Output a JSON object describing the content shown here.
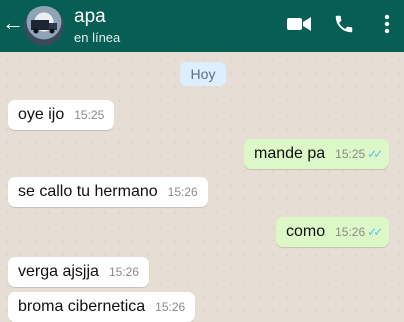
{
  "header": {
    "contact_name": "apa",
    "status": "en línea",
    "icons": [
      "back-arrow-icon",
      "video-call-icon",
      "phone-icon",
      "more-vertical-icon"
    ]
  },
  "chat": {
    "date_badge": "Hoy",
    "messages": [
      {
        "direction": "in",
        "text": "oye ijo",
        "time": "15:25"
      },
      {
        "direction": "out",
        "text": "mande pa",
        "time": "15:25",
        "read": true
      },
      {
        "direction": "in",
        "text": "se callo tu hermano",
        "time": "15:26"
      },
      {
        "direction": "out",
        "text": "como",
        "time": "15:26",
        "read": true
      },
      {
        "direction": "in",
        "text": "verga ajsjja",
        "time": "15:26"
      },
      {
        "direction": "in",
        "text": "broma cibernetica",
        "time": "15:26"
      }
    ]
  },
  "colors": {
    "header": "#075e54",
    "incoming": "#ffffff",
    "outgoing": "#dcf8c6",
    "read_ticks": "#4fc3f7",
    "background": "#e6ddd4"
  }
}
